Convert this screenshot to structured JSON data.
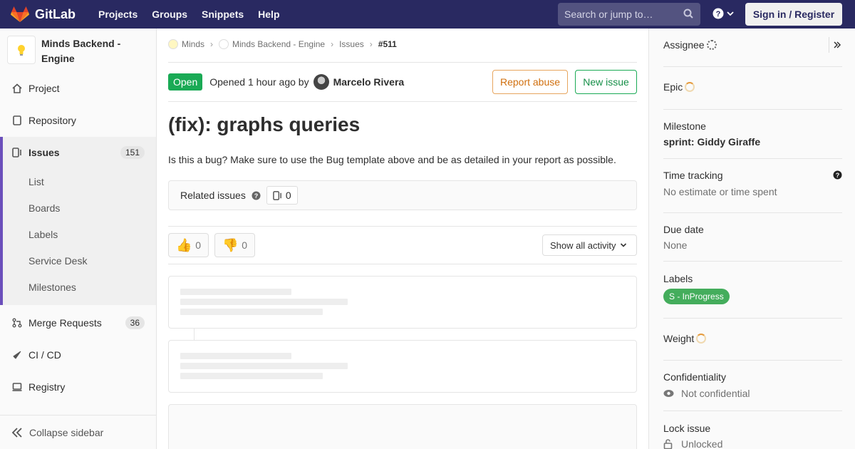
{
  "navbar": {
    "brand": "GitLab",
    "links": [
      "Projects",
      "Groups",
      "Snippets",
      "Help"
    ],
    "search_placeholder": "Search or jump to…",
    "signin": "Sign in / Register",
    "bg_color": "#292961"
  },
  "sidebar": {
    "project_name": "Minds Backend - Engine",
    "items": [
      {
        "label": "Project",
        "icon": "home-icon"
      },
      {
        "label": "Repository",
        "icon": "doc-icon"
      },
      {
        "label": "Issues",
        "icon": "issues-icon",
        "count": "151"
      },
      {
        "label": "Merge Requests",
        "icon": "merge-request-icon",
        "count": "36"
      },
      {
        "label": "CI / CD",
        "icon": "rocket-icon"
      },
      {
        "label": "Registry",
        "icon": "disk-icon"
      }
    ],
    "subitems": [
      "List",
      "Boards",
      "Labels",
      "Service Desk",
      "Milestones"
    ],
    "collapse": "Collapse sidebar",
    "accent": "#6b4fbb"
  },
  "breadcrumb": {
    "items": [
      "Minds",
      "Minds Backend - Engine",
      "Issues"
    ],
    "current": "#511"
  },
  "issue": {
    "status": "Open",
    "opened": "Opened 1 hour ago by",
    "author": "Marcelo Rivera",
    "report_abuse": "Report abuse",
    "new_issue": "New issue",
    "title": "(fix): graphs queries",
    "description": "Is this a bug? Make sure to use the Bug template above and be as detailed in your report as possible.",
    "related_label": "Related issues",
    "related_count": "0",
    "thumbs_up": "0",
    "thumbs_down": "0",
    "activity_filter": "Show all activity"
  },
  "right_sidebar": {
    "assignee": "Assignee",
    "epic": "Epic",
    "milestone_title": "Milestone",
    "milestone_value": "sprint: Giddy Giraffe",
    "time_title": "Time tracking",
    "time_value": "No estimate or time spent",
    "due_title": "Due date",
    "due_value": "None",
    "labels_title": "Labels",
    "label_value": "S - InProgress",
    "weight_title": "Weight",
    "conf_title": "Confidentiality",
    "conf_value": "Not confidential",
    "lock_title": "Lock issue",
    "lock_value": "Unlocked"
  }
}
